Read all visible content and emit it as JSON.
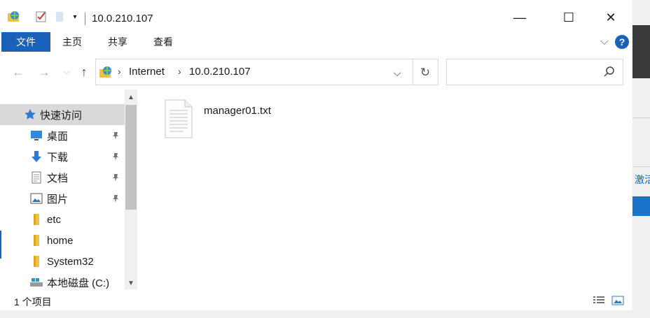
{
  "window": {
    "title": "10.0.210.107",
    "controls": {
      "minimize": "—",
      "maximize": "☐",
      "close": "✕"
    }
  },
  "ribbon": {
    "tabs": [
      {
        "label": "文件",
        "active": true
      },
      {
        "label": "主页"
      },
      {
        "label": "共享"
      },
      {
        "label": "查看"
      }
    ],
    "help": "?"
  },
  "address": {
    "breadcrumbs": [
      "Internet",
      "10.0.210.107"
    ],
    "search_placeholder": ""
  },
  "nav": {
    "items": [
      {
        "label": "快速访问",
        "icon": "star-icon",
        "selected": true
      },
      {
        "label": "桌面",
        "icon": "desktop-icon",
        "pinned": true
      },
      {
        "label": "下载",
        "icon": "download-icon",
        "pinned": true
      },
      {
        "label": "文档",
        "icon": "document-icon",
        "pinned": true
      },
      {
        "label": "图片",
        "icon": "picture-icon",
        "pinned": true
      },
      {
        "label": "etc",
        "icon": "folder-icon"
      },
      {
        "label": "home",
        "icon": "folder-icon"
      },
      {
        "label": "System32",
        "icon": "folder-icon"
      },
      {
        "label": "本地磁盘 (C:)",
        "icon": "drive-icon"
      }
    ]
  },
  "content": {
    "files": [
      {
        "name": "manager01.txt",
        "icon": "text-file-icon"
      }
    ]
  },
  "status": {
    "item_count": "1 个项目"
  },
  "backdrop": {
    "text": "激活"
  },
  "colors": {
    "accent": "#1a62b8",
    "selected_bg": "#d9d9d9"
  }
}
